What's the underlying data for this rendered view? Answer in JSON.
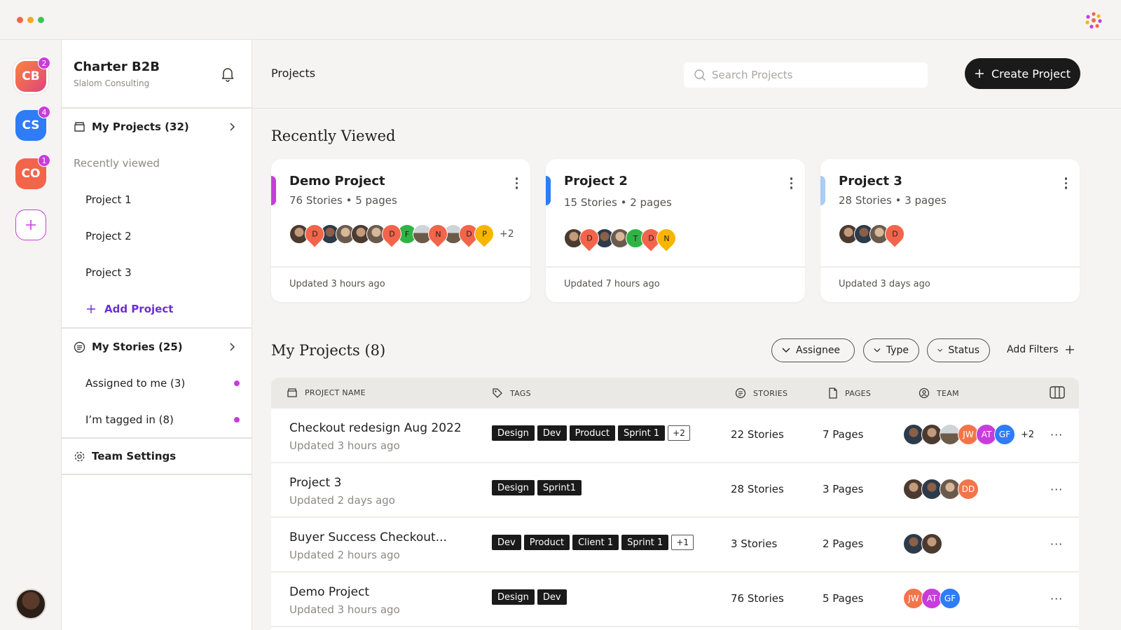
{
  "workspaces": [
    {
      "initials": "CB",
      "badge": "2",
      "color": "#f2654a"
    },
    {
      "initials": "CS",
      "badge": "4",
      "color": "#2e7cf6"
    },
    {
      "initials": "CO",
      "badge": "1",
      "color": "#f2654a"
    }
  ],
  "sidebar": {
    "org_name": "Charter B2B",
    "org_sub": "Slalom Consulting",
    "my_projects": "My Projects (32)",
    "recently_viewed": "Recently viewed",
    "projects": [
      "Project 1",
      "Project 2",
      "Project 3"
    ],
    "add_project": "Add Project",
    "my_stories": "My Stories (25)",
    "assigned": "Assigned to me (3)",
    "tagged": "I’m tagged in (8)",
    "team_settings": "Team Settings"
  },
  "topbar": {
    "breadcrumb": "Projects",
    "search_placeholder": "Search Projects",
    "create_label": "Create Project"
  },
  "recent": {
    "title": "Recently Viewed",
    "cards": [
      {
        "title": "Demo Project",
        "meta": "76 Stories • 5 pages",
        "updated": "Updated 3 hours ago",
        "more": "+2",
        "accent": "#c83cdc"
      },
      {
        "title": "Project 2",
        "meta": "15 Stories • 2 pages",
        "updated": "Updated 7 hours ago",
        "accent": "#2e7cf6"
      },
      {
        "title": "Project 3",
        "meta": "28 Stories • 3 pages",
        "updated": "Updated 3 days ago",
        "accent": "#a9cdf5"
      }
    ]
  },
  "myprojects": {
    "title": "My Projects (8)",
    "filters": [
      "Assignee",
      "Type",
      "Status"
    ],
    "add_filters": "Add Filters",
    "headers": [
      "PROJECT NAME",
      "TAGS",
      "STORIES",
      "PAGES",
      "TEAM"
    ],
    "rows": [
      {
        "name": "Checkout redesign Aug 2022",
        "updated": "Updated 3 hours ago",
        "tags": [
          "Design",
          "Dev",
          "Product",
          "Sprint 1"
        ],
        "tag_more": "+2",
        "stories": "22 Stories",
        "pages": "7 Pages",
        "team_more": "+2"
      },
      {
        "name": "Project 3",
        "updated": "Updated 2 days ago",
        "tags": [
          "Design",
          "Sprint1"
        ],
        "stories": "28 Stories",
        "pages": "3 Pages"
      },
      {
        "name": "Buyer Success Checkout...",
        "updated": "Updated 2 hours ago",
        "tags": [
          "Dev",
          "Product",
          "Client 1",
          "Sprint 1"
        ],
        "tag_more": "+1",
        "stories": "3 Stories",
        "pages": "2 Pages"
      },
      {
        "name": "Demo Project",
        "updated": "Updated 3 hours ago",
        "tags": [
          "Design",
          "Dev"
        ],
        "stories": "76 Stories",
        "pages": "5 Pages"
      }
    ]
  },
  "initials": {
    "d": "D",
    "f": "F",
    "n": "N",
    "p": "P",
    "t": "T",
    "jw": "JW",
    "at": "AT",
    "gf": "GF",
    "dd": "DD"
  },
  "colors": {
    "accent_purple": "#c83cdc",
    "accent_blue": "#2e7cf6",
    "accent_orange": "#f2654a",
    "link_purple": "#6a2ed8",
    "avatar_green": "#2fb344",
    "avatar_yellow": "#f7b500"
  }
}
